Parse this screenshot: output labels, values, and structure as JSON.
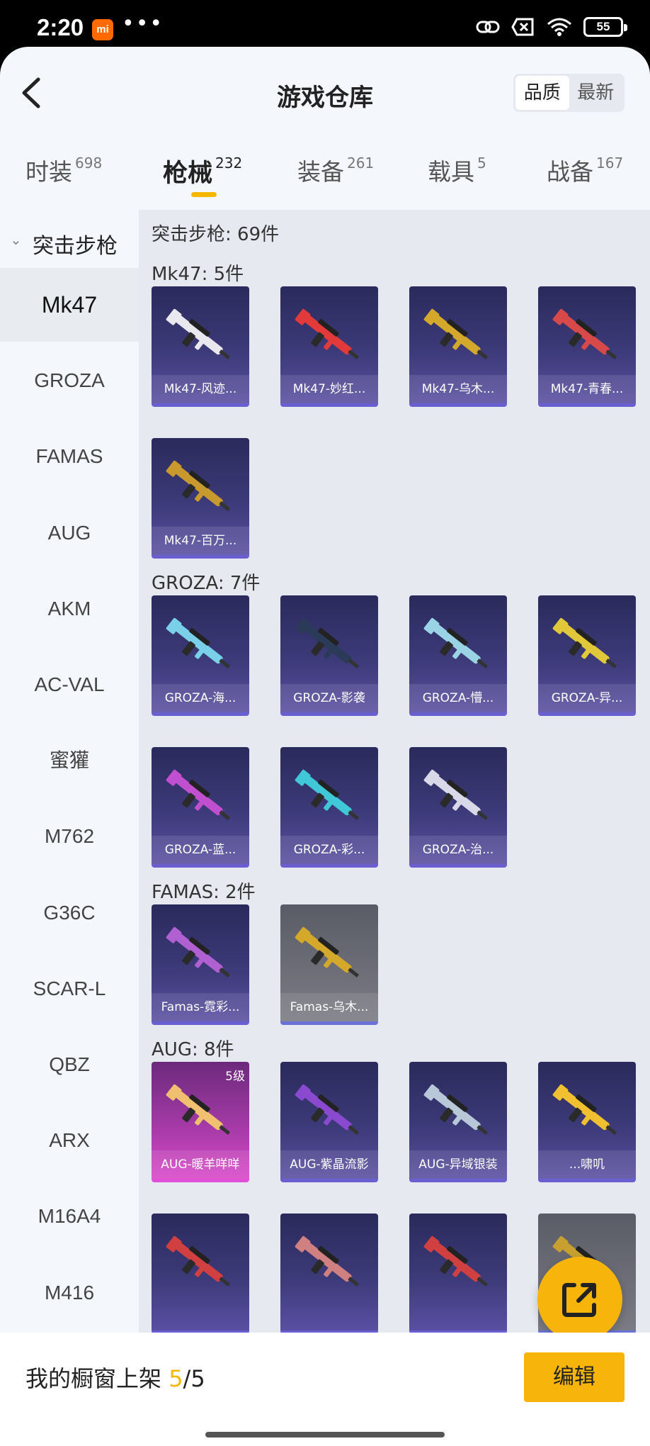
{
  "status": {
    "time": "2:20",
    "mi_logo": "mi",
    "dots": "•••",
    "battery": "55"
  },
  "header": {
    "title": "游戏仓库",
    "sort_options": [
      "品质",
      "最新"
    ],
    "sort_selected": "品质"
  },
  "tabs": [
    {
      "label": "时装",
      "count": "698"
    },
    {
      "label": "枪械",
      "count": "232"
    },
    {
      "label": "装备",
      "count": "261"
    },
    {
      "label": "载具",
      "count": "5"
    },
    {
      "label": "战备",
      "count": "167"
    }
  ],
  "active_tab": "枪械",
  "sidebar": {
    "category": "突击步枪",
    "items": [
      "Mk47",
      "GROZA",
      "FAMAS",
      "AUG",
      "AKM",
      "AC-VAL",
      "蜜獾",
      "M762",
      "G36C",
      "SCAR-L",
      "QBZ",
      "ARX",
      "M16A4",
      "M416"
    ],
    "active": "Mk47"
  },
  "main": {
    "total_label": "突击步枪: 69件",
    "sections": [
      {
        "label": "Mk47: 5件",
        "items": [
          {
            "name": "Mk47-风迹...",
            "color": "#e8e8ee"
          },
          {
            "name": "Mk47-妙红...",
            "color": "#e23a3a"
          },
          {
            "name": "Mk47-乌木...",
            "color": "#d4a82a"
          },
          {
            "name": "Mk47-青春...",
            "color": "#d84a4a"
          },
          {
            "name": "Mk47-百万...",
            "color": "#c89a2e"
          }
        ]
      },
      {
        "label": "GROZA: 7件",
        "items": [
          {
            "name": "GROZA-海...",
            "color": "#7ad0e8"
          },
          {
            "name": "GROZA-影袭",
            "color": "#2a3a58"
          },
          {
            "name": "GROZA-懵...",
            "color": "#9ad2e6"
          },
          {
            "name": "GROZA-异...",
            "color": "#e0c83a"
          },
          {
            "name": "GROZA-蓝...",
            "color": "#c050d0"
          },
          {
            "name": "GROZA-彩...",
            "color": "#40c8d8"
          },
          {
            "name": "GROZA-治...",
            "color": "#d8d8e8"
          }
        ]
      },
      {
        "label": "FAMAS: 2件",
        "items": [
          {
            "name": "Famas-霓彩...",
            "color": "#b060d0"
          },
          {
            "name": "Famas-乌木...",
            "color": "#d4a82a",
            "grey": true
          }
        ]
      },
      {
        "label": "AUG: 8件",
        "items": [
          {
            "name": "AUG-暖羊咩咩",
            "color": "#f0c070",
            "pink": true,
            "level": "5级"
          },
          {
            "name": "AUG-紫晶流影",
            "color": "#8a4ad0"
          },
          {
            "name": "AUG-异域银装",
            "color": "#b8c8d8"
          },
          {
            "name": "...啸叽",
            "color": "#f0c030"
          },
          {
            "name": "",
            "color": "#d04040"
          },
          {
            "name": "",
            "color": "#d08080"
          },
          {
            "name": "",
            "color": "#d04040"
          },
          {
            "name": "",
            "color": "#c8a030",
            "grey": true
          }
        ]
      }
    ]
  },
  "bottom": {
    "label": "我的橱窗上架",
    "current": "5",
    "total": "/5",
    "edit": "编辑"
  }
}
